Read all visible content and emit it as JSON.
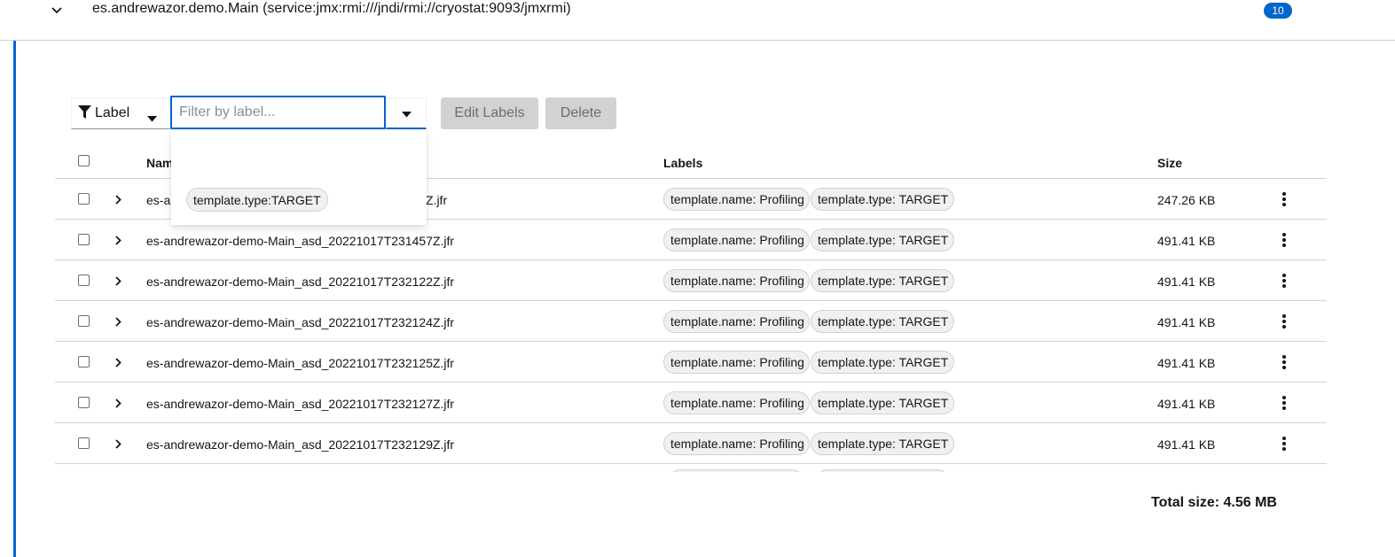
{
  "target": {
    "title": "es.andrewazor.demo.Main (service:jmx:rmi:///jndi/rmi://cryostat:9093/jmxrmi)",
    "count": "10"
  },
  "toolbar": {
    "filter_category": "Label",
    "filter_placeholder": "Filter by label...",
    "filter_value": "",
    "edit_labels": "Edit Labels",
    "delete": "Delete"
  },
  "dropdown": {
    "options": [
      "template.type:TARGET"
    ]
  },
  "table": {
    "headers": {
      "name": "Name",
      "labels": "Labels",
      "size": "Size"
    },
    "rows": [
      {
        "name_visible": "es-a",
        "name_tail": "Z.jfr",
        "labels": [
          "template.name: Profiling",
          "template.type: TARGET"
        ],
        "size": "247.26 KB"
      },
      {
        "name": "es-andrewazor-demo-Main_asd_20221017T231457Z.jfr",
        "labels": [
          "template.name: Profiling",
          "template.type: TARGET"
        ],
        "size": "491.41 KB"
      },
      {
        "name": "es-andrewazor-demo-Main_asd_20221017T232122Z.jfr",
        "labels": [
          "template.name: Profiling",
          "template.type: TARGET"
        ],
        "size": "491.41 KB"
      },
      {
        "name": "es-andrewazor-demo-Main_asd_20221017T232124Z.jfr",
        "labels": [
          "template.name: Profiling",
          "template.type: TARGET"
        ],
        "size": "491.41 KB"
      },
      {
        "name": "es-andrewazor-demo-Main_asd_20221017T232125Z.jfr",
        "labels": [
          "template.name: Profiling",
          "template.type: TARGET"
        ],
        "size": "491.41 KB"
      },
      {
        "name": "es-andrewazor-demo-Main_asd_20221017T232127Z.jfr",
        "labels": [
          "template.name: Profiling",
          "template.type: TARGET"
        ],
        "size": "491.41 KB"
      },
      {
        "name": "es-andrewazor-demo-Main_asd_20221017T232129Z.jfr",
        "labels": [
          "template.name: Profiling",
          "template.type: TARGET"
        ],
        "size": "491.41 KB"
      }
    ]
  },
  "footer": {
    "total_size": "Total size: 4.56 MB"
  },
  "colors": {
    "accent": "#0066cc",
    "disabled_bg": "#d2d2d2",
    "chip_bg": "#f0f0f0",
    "border": "#d2d2d2"
  },
  "icons": {
    "target_toggle": "chevron-down-icon",
    "filter": "filter-icon",
    "caret": "caret-down-icon",
    "row_expand": "chevron-right-icon",
    "row_actions": "kebab-icon"
  }
}
